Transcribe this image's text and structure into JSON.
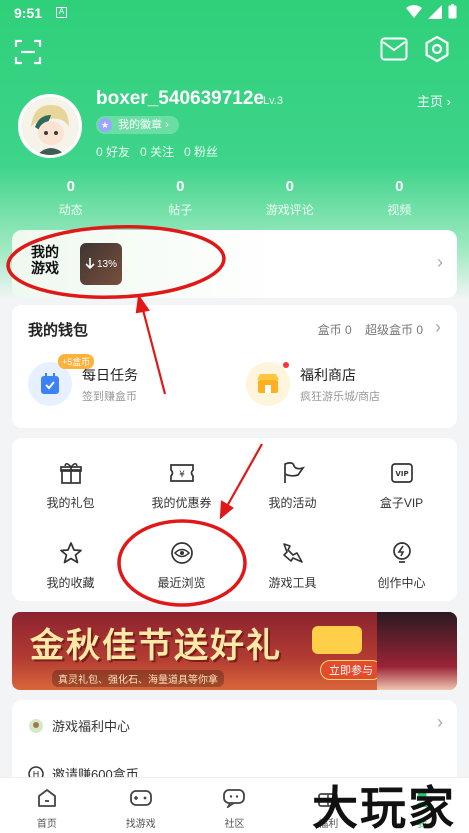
{
  "status_bar": {
    "time": "9:51",
    "sim_label": "A"
  },
  "profile": {
    "username": "boxer_540639712e",
    "level": "Lv.3",
    "homepage_label": "主页",
    "badge_label": "我的徽章",
    "friends": "0 好友",
    "following": "0 关注",
    "followers": "0 粉丝"
  },
  "stats": [
    {
      "value": "0",
      "label": "动态"
    },
    {
      "value": "0",
      "label": "帖子"
    },
    {
      "value": "0",
      "label": "游戏评论"
    },
    {
      "value": "0",
      "label": "视频"
    }
  ],
  "my_games": {
    "logo_text": "我的游戏",
    "download_percent": "13%"
  },
  "wallet": {
    "title": "我的钱包",
    "coins": "盒币 0",
    "super_coins": "超级盒币 0",
    "daily_task_title": "每日任务",
    "daily_task_sub": "签到赚盒币",
    "daily_task_reward": "+5盒币",
    "shop_title": "福利商店",
    "shop_sub": "疯狂游乐城/商店"
  },
  "menu": [
    {
      "label": "我的礼包"
    },
    {
      "label": "我的优惠券"
    },
    {
      "label": "我的活动"
    },
    {
      "label": "盒子VIP"
    },
    {
      "label": "我的收藏"
    },
    {
      "label": "最近浏览"
    },
    {
      "label": "游戏工具"
    },
    {
      "label": "创作中心"
    }
  ],
  "banner": {
    "title": "金秋佳节送好礼",
    "subtitle": "真灵礼包、强化石、海量道具等你拿",
    "button": "立即参与"
  },
  "list": [
    {
      "label": "游戏福利中心"
    },
    {
      "label": "邀请赚600盒币"
    }
  ],
  "tabs": [
    {
      "label": "首页"
    },
    {
      "label": "找游戏"
    },
    {
      "label": "社区"
    },
    {
      "label": "福利"
    },
    {
      "label": "我"
    }
  ],
  "watermark": "大玩家",
  "colors": {
    "brand_green": "#2fd07a",
    "annotation_red": "#e01818",
    "coin_orange": "#ffb13b"
  }
}
